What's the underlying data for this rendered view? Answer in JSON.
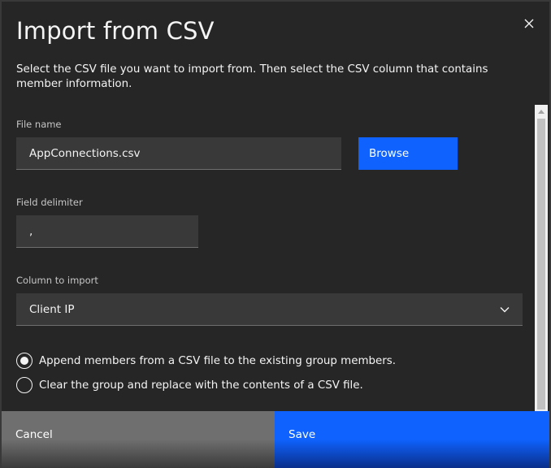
{
  "dialog": {
    "title": "Import from CSV",
    "description": "Select the CSV file you want to import from. Then select the CSV column that contains member information.",
    "close_icon": "close-icon"
  },
  "file_name": {
    "label": "File name",
    "value": "AppConnections.csv",
    "browse_label": "Browse"
  },
  "field_delimiter": {
    "label": "Field delimiter",
    "value": ","
  },
  "column_to_import": {
    "label": "Column to import",
    "selected": "Client IP",
    "icon": "chevron-down-icon"
  },
  "import_mode": {
    "options": [
      {
        "label": "Append members from a CSV file to the existing group members.",
        "selected": true
      },
      {
        "label": "Clear the group and replace with the contents of a CSV file.",
        "selected": false
      }
    ]
  },
  "footer": {
    "cancel_label": "Cancel",
    "save_label": "Save"
  },
  "colors": {
    "background": "#262626",
    "field": "#393939",
    "primary": "#0f62fe",
    "secondary": "#6f6f6f",
    "text": "#f4f4f4"
  }
}
